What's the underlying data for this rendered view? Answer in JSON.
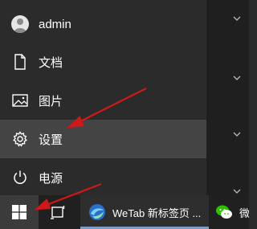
{
  "start_menu": {
    "user": {
      "label": "admin",
      "icon": "user-avatar-icon"
    },
    "items": [
      {
        "label": "文档",
        "icon": "document-icon"
      },
      {
        "label": "图片",
        "icon": "picture-icon"
      },
      {
        "label": "设置",
        "icon": "gear-icon",
        "highlighted": true
      },
      {
        "label": "电源",
        "icon": "power-icon"
      }
    ]
  },
  "taskbar": {
    "start_icon": "windows-logo-icon",
    "task_view_icon": "task-view-icon",
    "tasks": [
      {
        "label": "WeTab 新标签页 ...",
        "icon": "wetab-browser-icon"
      },
      {
        "label": "微",
        "icon": "wechat-icon"
      }
    ]
  },
  "colors": {
    "annotation_arrow": "#d01818",
    "menu_background": "#2b2b2b",
    "menu_hover": "#444444",
    "taskbar": "#202020"
  }
}
